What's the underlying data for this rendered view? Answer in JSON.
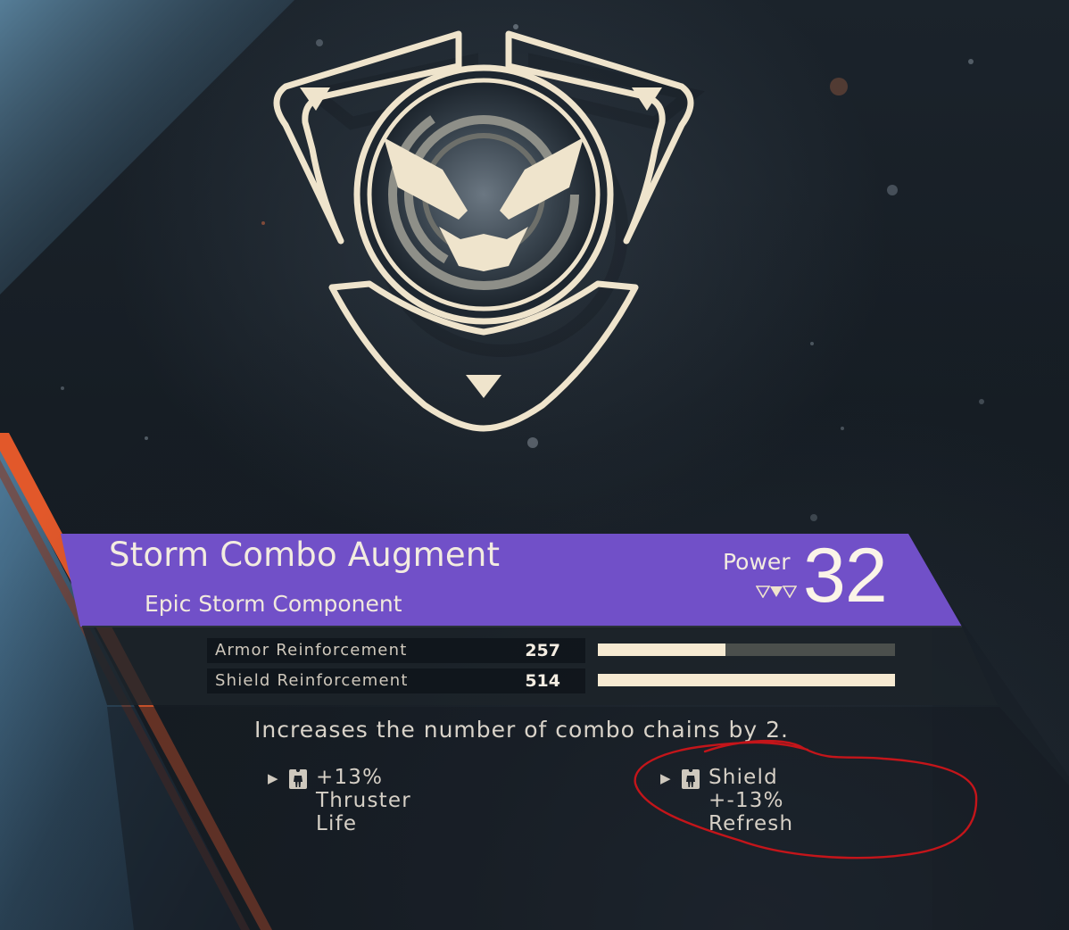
{
  "item": {
    "name": "Storm Combo Augment",
    "type": "Epic Storm Component",
    "power_label": "Power",
    "power_value": "32",
    "rarity_color": "#7150c8"
  },
  "stats": [
    {
      "label": "Armor Reinforcement",
      "value": "257",
      "fill": 0.43
    },
    {
      "label": "Shield Reinforcement",
      "value": "514",
      "fill": 1.0
    }
  ],
  "description": "Increases the number of combo chains by 2.",
  "perks": [
    {
      "arrow": "▶",
      "icon": "javelin-figure-icon",
      "text": "+13% Thruster Life"
    },
    {
      "arrow": "▶",
      "icon": "javelin-figure-icon",
      "text": "Shield +-13% Refresh"
    }
  ],
  "colors": {
    "accent_orange": "#e2582a",
    "cream": "#f3ead6",
    "annotation_red": "#c4151a"
  }
}
